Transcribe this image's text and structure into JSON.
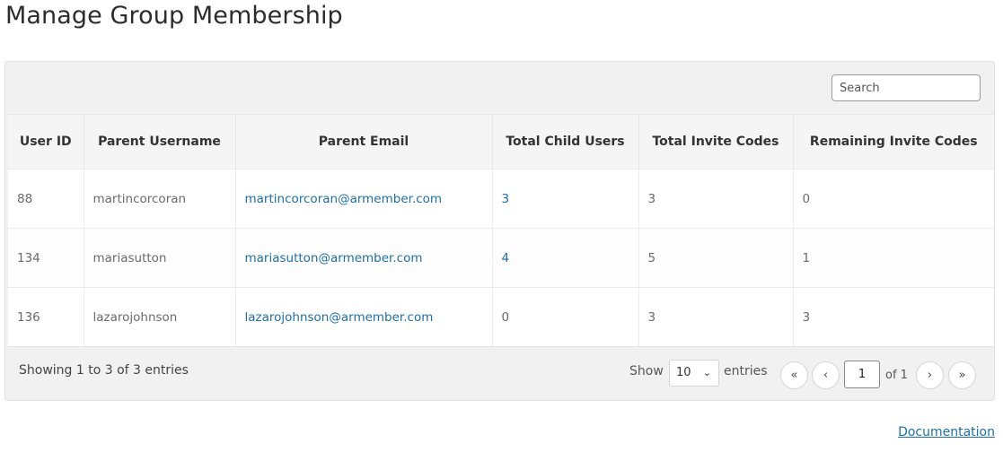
{
  "page": {
    "title": "Manage Group Membership"
  },
  "search": {
    "placeholder": "Search",
    "value": ""
  },
  "table": {
    "headers": [
      "User ID",
      "Parent Username",
      "Parent Email",
      "Total Child Users",
      "Total Invite Codes",
      "Remaining Invite Codes"
    ],
    "rows": [
      {
        "user_id": "88",
        "username": "martincorcoran",
        "email": "martincorcoran@armember.com",
        "child_users": "3",
        "invite_codes": "3",
        "remaining": "0"
      },
      {
        "user_id": "134",
        "username": "mariasutton",
        "email": "mariasutton@armember.com",
        "child_users": "4",
        "invite_codes": "5",
        "remaining": "1"
      },
      {
        "user_id": "136",
        "username": "lazarojohnson",
        "email": "lazarojohnson@armember.com",
        "child_users": "0",
        "invite_codes": "3",
        "remaining": "3"
      }
    ]
  },
  "footer": {
    "showing": "Showing 1 to 3 of 3 entries",
    "show_label": "Show",
    "entries_label": "entries",
    "page_size": "10",
    "current_page": "1",
    "of_pages": "of 1"
  },
  "icons": {
    "first": "«",
    "prev": "‹",
    "next": "›",
    "last": "»",
    "dropdown": "⌄"
  },
  "links": {
    "documentation": "Documentation"
  },
  "colors": {
    "link": "#1f6fa5",
    "panel": "#f1f1f1"
  }
}
